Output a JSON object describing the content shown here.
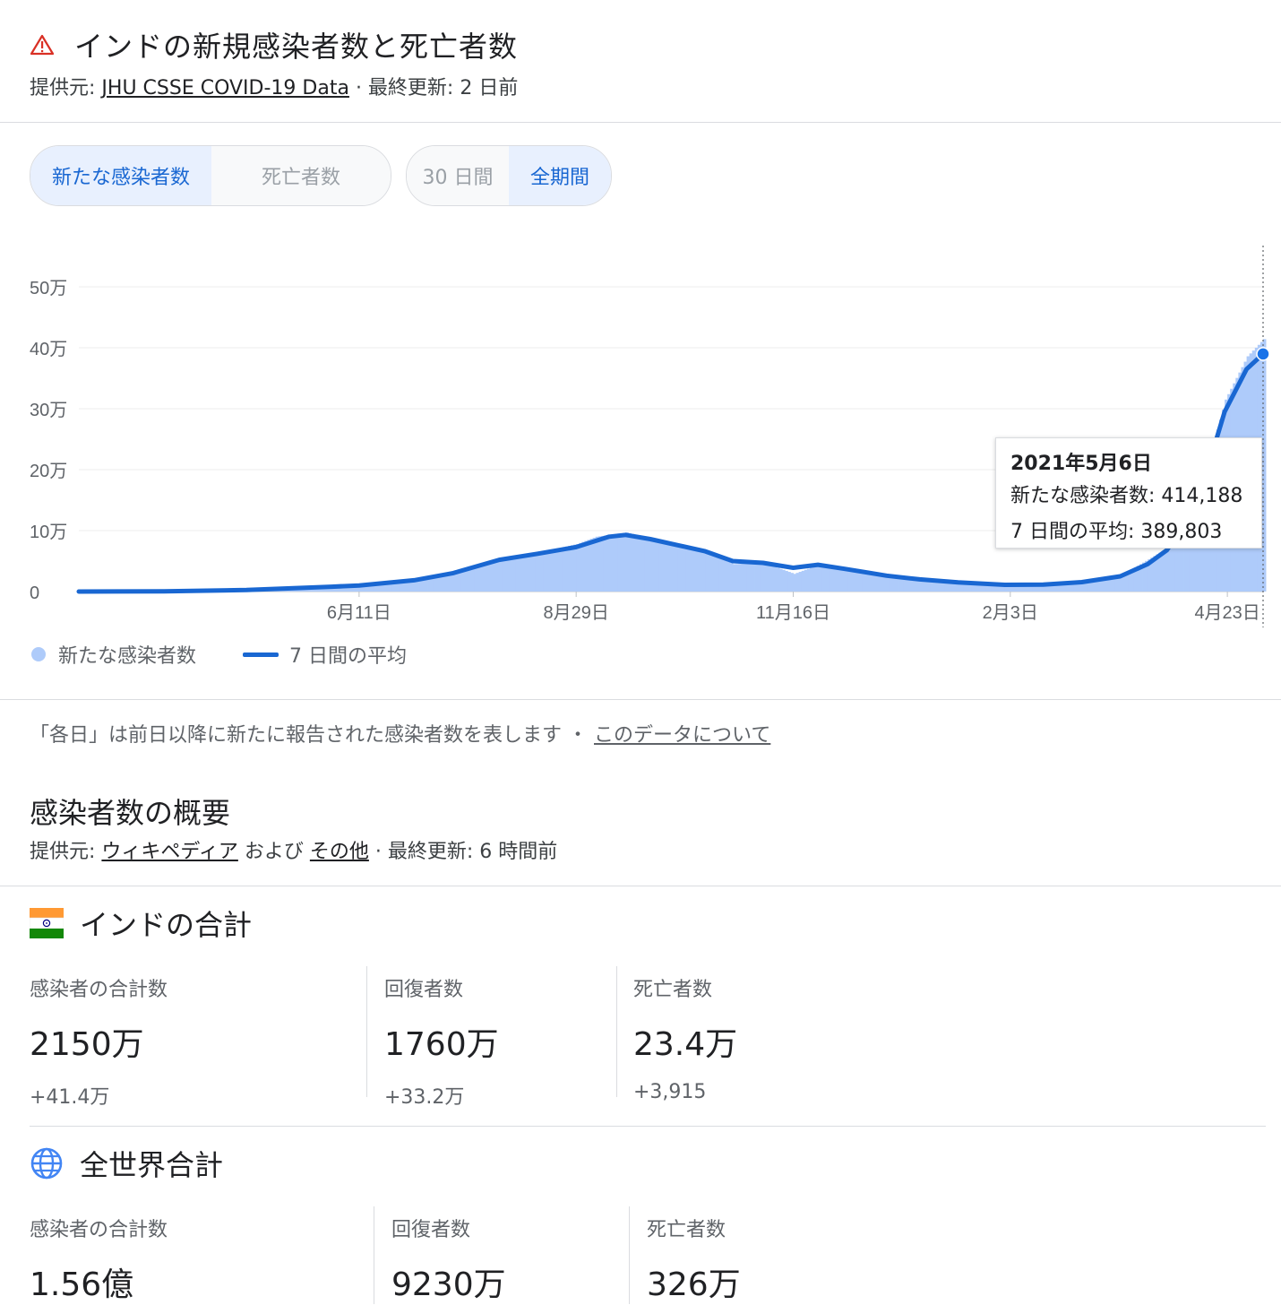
{
  "header": {
    "title": "インドの新規感染者数と死亡者数",
    "source_prefix": "提供元: ",
    "source_link": "JHU CSSE COVID-19 Data",
    "updated": " · 最終更新: 2 日前"
  },
  "toggles": {
    "metric": [
      {
        "label": "新たな感染者数",
        "active": true
      },
      {
        "label": "死亡者数",
        "active": false
      }
    ],
    "range": [
      {
        "label": "30 日間",
        "active": false
      },
      {
        "label": "全期間",
        "active": true
      }
    ]
  },
  "colors": {
    "bar": "#aecbfa",
    "line": "#1967d2",
    "accent": "#1a73e8",
    "warning": "#d93025"
  },
  "chart_data": {
    "type": "bar",
    "x_start": "2020-03-01",
    "x_end": "2021-05-06",
    "xticks": [
      {
        "date": "2020-06-11",
        "label": "6月11日"
      },
      {
        "date": "2020-08-29",
        "label": "8月29日"
      },
      {
        "date": "2020-11-16",
        "label": "11月16日"
      },
      {
        "date": "2021-02-03",
        "label": "2月3日"
      },
      {
        "date": "2021-04-23",
        "label": "4月23日"
      }
    ],
    "yticks": [
      {
        "value": 0,
        "label": "0"
      },
      {
        "value": 100000,
        "label": "10万"
      },
      {
        "value": 200000,
        "label": "20万"
      },
      {
        "value": 300000,
        "label": "30万"
      },
      {
        "value": 400000,
        "label": "40万"
      },
      {
        "value": 500000,
        "label": "50万"
      }
    ],
    "ylim": [
      0,
      500000
    ],
    "grid": true,
    "series": [
      {
        "name": "新たな感染者数",
        "kind": "bar",
        "points": [
          [
            "2020-03-15",
            100
          ],
          [
            "2020-04-01",
            1800
          ],
          [
            "2020-04-15",
            1100
          ],
          [
            "2020-05-01",
            2400
          ],
          [
            "2020-05-15",
            4000
          ],
          [
            "2020-06-01",
            8000
          ],
          [
            "2020-06-15",
            11000
          ],
          [
            "2020-07-01",
            18500
          ],
          [
            "2020-07-15",
            32000
          ],
          [
            "2020-08-01",
            54000
          ],
          [
            "2020-08-15",
            64000
          ],
          [
            "2020-08-29",
            78000
          ],
          [
            "2020-09-05",
            90000
          ],
          [
            "2020-09-16",
            97000
          ],
          [
            "2020-09-25",
            86000
          ],
          [
            "2020-10-05",
            74000
          ],
          [
            "2020-10-15",
            64000
          ],
          [
            "2020-10-25",
            45000
          ],
          [
            "2020-11-05",
            47000
          ],
          [
            "2020-11-16",
            29000
          ],
          [
            "2020-11-25",
            44000
          ],
          [
            "2020-12-05",
            36000
          ],
          [
            "2020-12-20",
            24000
          ],
          [
            "2021-01-01",
            20000
          ],
          [
            "2021-01-15",
            15000
          ],
          [
            "2021-02-01",
            11000
          ],
          [
            "2021-02-15",
            11500
          ],
          [
            "2021-03-01",
            15000
          ],
          [
            "2021-03-15",
            26000
          ],
          [
            "2021-03-25",
            53000
          ],
          [
            "2021-04-01",
            72000
          ],
          [
            "2021-04-08",
            126000
          ],
          [
            "2021-04-15",
            200000
          ],
          [
            "2021-04-22",
            315000
          ],
          [
            "2021-04-30",
            386000
          ],
          [
            "2021-05-06",
            414188
          ]
        ]
      },
      {
        "name": "7 日間の平均",
        "kind": "line",
        "points": [
          [
            "2020-03-01",
            0
          ],
          [
            "2020-04-01",
            500
          ],
          [
            "2020-05-01",
            2500
          ],
          [
            "2020-06-01",
            8000
          ],
          [
            "2020-06-11",
            10000
          ],
          [
            "2020-07-01",
            18500
          ],
          [
            "2020-07-15",
            30000
          ],
          [
            "2020-08-01",
            52000
          ],
          [
            "2020-08-15",
            62000
          ],
          [
            "2020-08-29",
            73000
          ],
          [
            "2020-09-10",
            90000
          ],
          [
            "2020-09-16",
            93000
          ],
          [
            "2020-09-25",
            86000
          ],
          [
            "2020-10-05",
            76000
          ],
          [
            "2020-10-15",
            66000
          ],
          [
            "2020-10-25",
            50000
          ],
          [
            "2020-11-05",
            47000
          ],
          [
            "2020-11-16",
            39000
          ],
          [
            "2020-11-25",
            44000
          ],
          [
            "2020-12-05",
            37000
          ],
          [
            "2020-12-20",
            26000
          ],
          [
            "2021-01-01",
            20000
          ],
          [
            "2021-01-15",
            15000
          ],
          [
            "2021-02-01",
            11000
          ],
          [
            "2021-02-15",
            11500
          ],
          [
            "2021-03-01",
            15500
          ],
          [
            "2021-03-15",
            25000
          ],
          [
            "2021-03-25",
            45000
          ],
          [
            "2021-04-01",
            68000
          ],
          [
            "2021-04-08",
            115000
          ],
          [
            "2021-04-15",
            190000
          ],
          [
            "2021-04-22",
            295000
          ],
          [
            "2021-04-30",
            365000
          ],
          [
            "2021-05-06",
            389803
          ]
        ]
      }
    ],
    "legend_placement": "bottom-left",
    "tooltip": {
      "date": "2021年5月6日",
      "row1": "新たな感染者数: 414,188",
      "row2": "7 日間の平均: 389,803"
    }
  },
  "legend": {
    "bar": "新たな感染者数",
    "line": "7 日間の平均"
  },
  "note": {
    "text": "「各日」は前日以降に新たに報告された感染者数を表します ・ ",
    "link": "このデータについて"
  },
  "overview": {
    "title": "感染者数の概要",
    "source_prefix": "提供元: ",
    "source_link1": "ウィキペディア",
    "source_mid": " および ",
    "source_link2": "その他",
    "updated": " · 最終更新: 6 時間前"
  },
  "india": {
    "title": "インドの合計",
    "flag_icon": "india-flag-icon",
    "stats": [
      {
        "label": "感染者の合計数",
        "value": "2150万",
        "delta": "+41.4万"
      },
      {
        "label": "回復者数",
        "value": "1760万",
        "delta": "+33.2万"
      },
      {
        "label": "死亡者数",
        "value": "23.4万",
        "delta": "+3,915"
      }
    ]
  },
  "world": {
    "title": "全世界合計",
    "globe_icon": "globe-icon",
    "stats": [
      {
        "label": "感染者の合計数",
        "value": "1.56億"
      },
      {
        "label": "回復者数",
        "value": "9230万"
      },
      {
        "label": "死亡者数",
        "value": "326万"
      }
    ]
  }
}
